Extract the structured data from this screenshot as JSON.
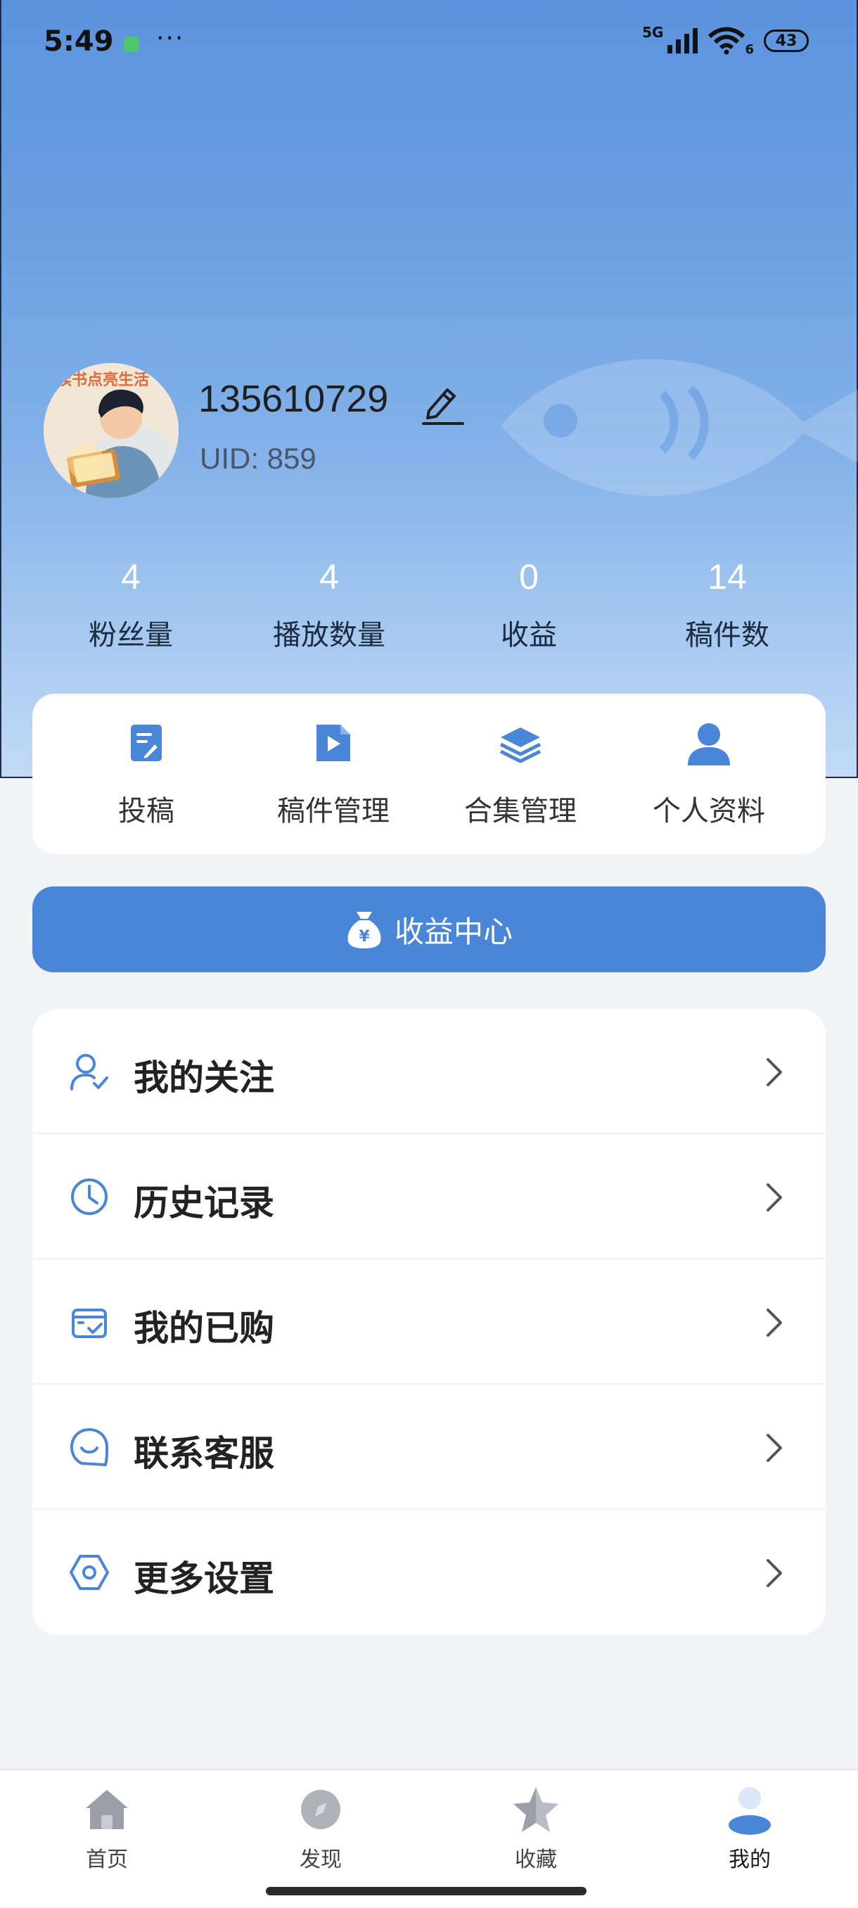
{
  "status_bar": {
    "time": "5:49",
    "dots": "···",
    "signal_label": "5G",
    "wifi_sub": "6",
    "battery": "43"
  },
  "profile": {
    "username": "135610729",
    "uid": "UID: 859",
    "avatar_caption": "读书点亮生活"
  },
  "stats": [
    {
      "value": "4",
      "label": "粉丝量"
    },
    {
      "value": "4",
      "label": "播放数量"
    },
    {
      "value": "0",
      "label": "收益"
    },
    {
      "value": "14",
      "label": "稿件数"
    }
  ],
  "quick_actions": [
    {
      "label": "投稿",
      "icon": "submit-icon"
    },
    {
      "label": "稿件管理",
      "icon": "manuscript-play-icon"
    },
    {
      "label": "合集管理",
      "icon": "layers-icon"
    },
    {
      "label": "个人资料",
      "icon": "user-icon"
    }
  ],
  "earnings_button": {
    "label": "收益中心",
    "icon": "money-bag-icon"
  },
  "menu": [
    {
      "label": "我的关注",
      "icon": "follow-user-icon"
    },
    {
      "label": "历史记录",
      "icon": "clock-icon"
    },
    {
      "label": "我的已购",
      "icon": "purchased-box-icon"
    },
    {
      "label": "联系客服",
      "icon": "chat-smile-icon"
    },
    {
      "label": "更多设置",
      "icon": "settings-hexagon-icon"
    }
  ],
  "bottom_nav": [
    {
      "label": "首页",
      "icon": "home-icon",
      "active": false
    },
    {
      "label": "发现",
      "icon": "compass-icon",
      "active": false
    },
    {
      "label": "收藏",
      "icon": "star-icon",
      "active": false
    },
    {
      "label": "我的",
      "icon": "profile-icon",
      "active": true
    }
  ],
  "colors": {
    "accent": "#4a86d8",
    "header_top": "#5c93dc",
    "header_bottom": "#c2dbf6",
    "page_bg": "#f1f3f6"
  }
}
